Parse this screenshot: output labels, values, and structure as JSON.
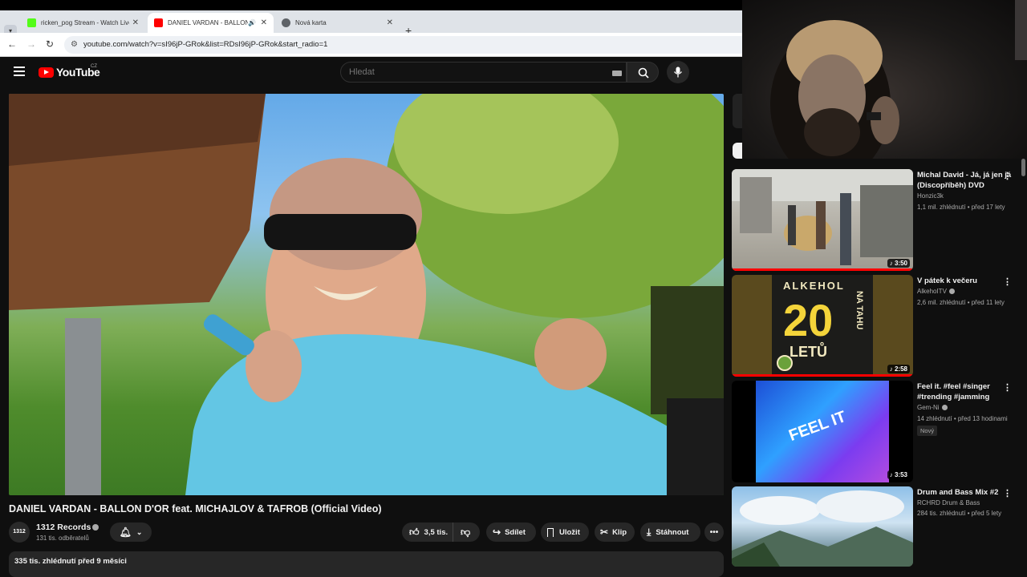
{
  "browser": {
    "tabs": [
      {
        "title": "ricken_pog Stream - Watch Live",
        "favicon_color": "#53fc18"
      },
      {
        "title": "DANIEL VARDAN - BALLON",
        "favicon_color": "#ff0000"
      },
      {
        "title": "Nová karta",
        "favicon_color": "#5f6368"
      }
    ],
    "url": "youtube.com/watch?v=sI96jP-GRok&list=RDsI96jP-GRok&start_radio=1"
  },
  "header": {
    "logo_text": "YouTube",
    "region": "CZ",
    "search_placeholder": "Hledat"
  },
  "video": {
    "title": "DANIEL VARDAN - BALLON D'OR feat. MICHAJLOV & TAFROB (Official Video)",
    "channel_avatar_text": "1312",
    "channel_name": "1312 Records",
    "subscribers": "131 tis. odběratelů",
    "likes": "3,5 tis.",
    "share_label": "Sdílet",
    "save_label": "Uložit",
    "clip_label": "Klip",
    "download_label": "Stáhnout",
    "views_line": "335 tis. zhlédnutí  před 9 měsíci"
  },
  "recommendations": [
    {
      "title": "Michal David - Já, já jen já (Discopříběh) DVD",
      "channel": "Honzic3k",
      "verified": false,
      "meta": "1,1 mil. zhlédnutí • před 17 lety",
      "duration": "3:50",
      "progress": 1.0,
      "badge": ""
    },
    {
      "title": "V pátek k večeru",
      "channel": "AlkehoITV",
      "verified": true,
      "meta": "2,6 mil. zhlédnutí • před 11 lety",
      "duration": "2:58",
      "progress": 1.0,
      "badge": "",
      "thumb_text": [
        "ALKEHOL",
        "20",
        "LETŮ",
        "NA TAHU"
      ]
    },
    {
      "title": "Feel it. #feel #singer #trending #jamming",
      "channel": "Gem-Ni",
      "verified": true,
      "meta": "14 zhlédnutí • před 13 hodinami",
      "duration": "3:53",
      "progress": 0,
      "badge": "Nový",
      "thumb_text": [
        "FEEL IT"
      ]
    },
    {
      "title": "Drum and Bass Mix #2",
      "channel": "RCHRD Drum & Bass",
      "verified": false,
      "meta": "284 tis. zhlédnutí • před 5 lety",
      "duration": "",
      "progress": 0,
      "badge": ""
    }
  ],
  "colors": {
    "accent": "#ff0000",
    "background": "#0f0f0f",
    "pill": "#272727"
  }
}
